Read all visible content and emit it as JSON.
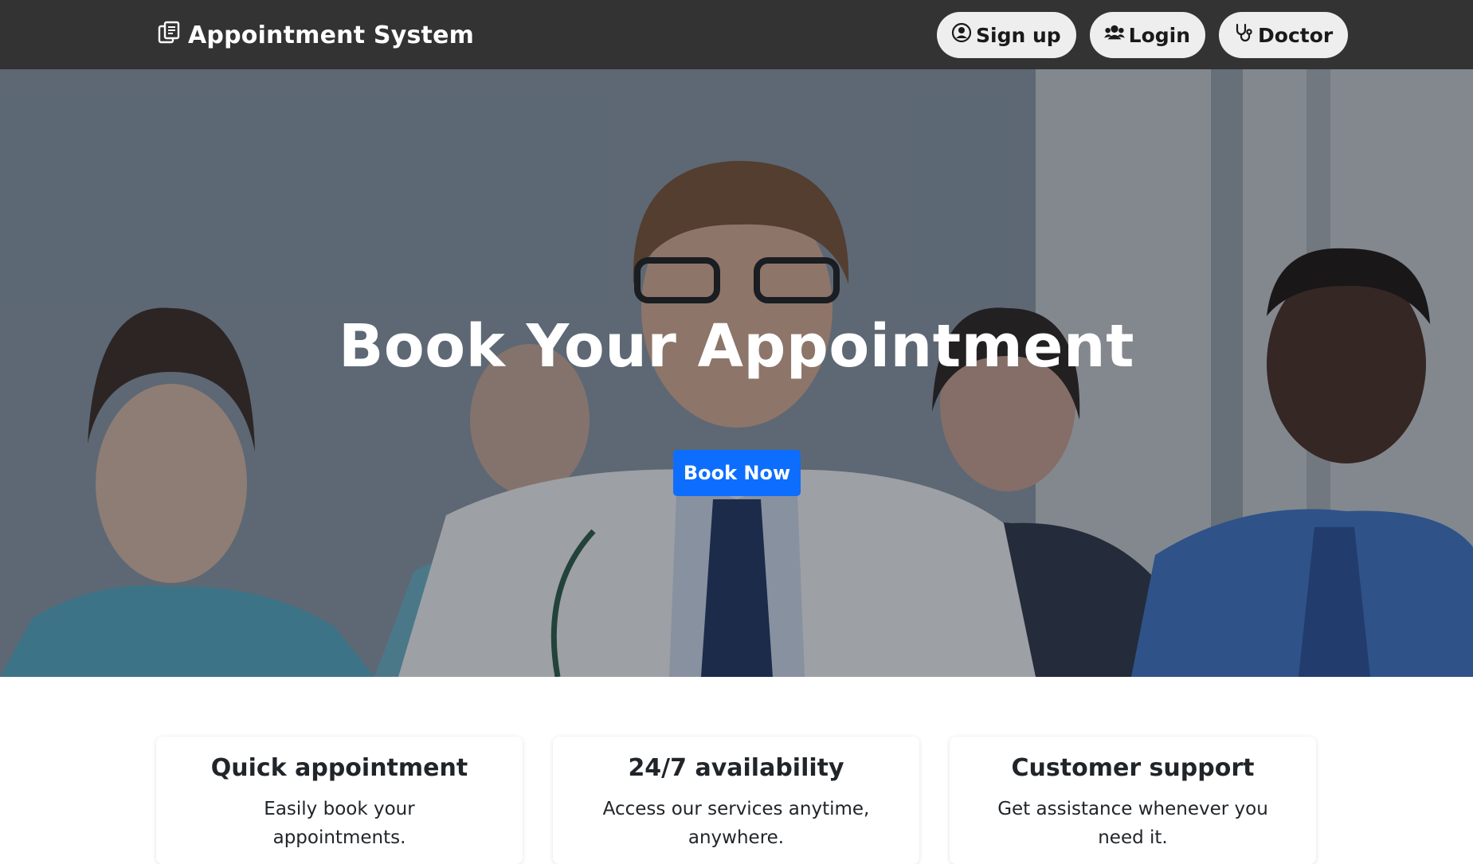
{
  "navbar": {
    "brand": "Appointment System",
    "brand_icon": "copy-icon",
    "buttons": [
      {
        "label": "Sign up",
        "icon": "user-circle-icon"
      },
      {
        "label": "Login",
        "icon": "users-icon"
      },
      {
        "label": "Doctor",
        "icon": "stethoscope-icon"
      }
    ]
  },
  "hero": {
    "title": "Book Your Appointment",
    "cta_label": "Book Now"
  },
  "features": [
    {
      "title": "Quick appointment",
      "text": "Easily book your appointments."
    },
    {
      "title": "24/7 availability",
      "text": "Access our services anytime, anywhere."
    },
    {
      "title": "Customer support",
      "text": "Get assistance whenever you need it."
    }
  ],
  "colors": {
    "navbar_bg": "#333333",
    "nav_button_bg": "#eeeeee",
    "primary": "#0d6efd"
  }
}
